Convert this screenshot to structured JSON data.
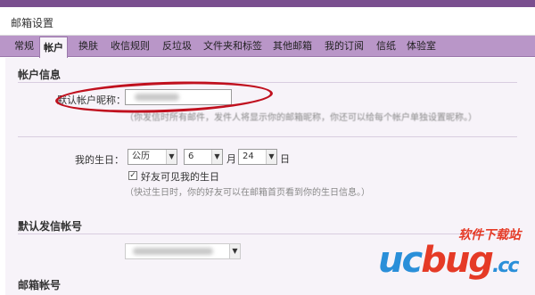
{
  "header": {
    "title": "邮箱设置"
  },
  "tabs": [
    {
      "label": "常规"
    },
    {
      "label": "帐户"
    },
    {
      "label": "换肤"
    },
    {
      "label": "收信规则"
    },
    {
      "label": "反垃圾"
    },
    {
      "label": "文件夹和标签"
    },
    {
      "label": "其他邮箱"
    },
    {
      "label": "我的订阅"
    },
    {
      "label": "信纸"
    },
    {
      "label": "体验室"
    }
  ],
  "account_info": {
    "heading": "帐户信息",
    "nickname_label": "默认帐户昵称：",
    "nickname_hint": "（你发信时所有邮件，发件人将显示你的邮箱昵称，你还可以给每个帐户单独设置昵称。）"
  },
  "birthday": {
    "label": "我的生日：",
    "calendar": "公历",
    "month": "6",
    "month_unit": "月",
    "day": "24",
    "day_unit": "日",
    "visible_checked": true,
    "visible_label": "好友可见我的生日",
    "hint": "（快过生日时，你的好友可以在邮箱首页看到你的生日信息。）"
  },
  "default_sender": {
    "heading": "默认发信帐号"
  },
  "mailbox_account": {
    "heading": "邮箱帐号"
  },
  "watermark": {
    "cn": "软件下载站",
    "uc": "uc",
    "bug": "bug",
    "cc": ".cc"
  },
  "colors": {
    "accent": "#7a4f8f",
    "tab_bar": "#b996c8",
    "panel": "#f7f3f9",
    "annotation": "#c0101e"
  }
}
